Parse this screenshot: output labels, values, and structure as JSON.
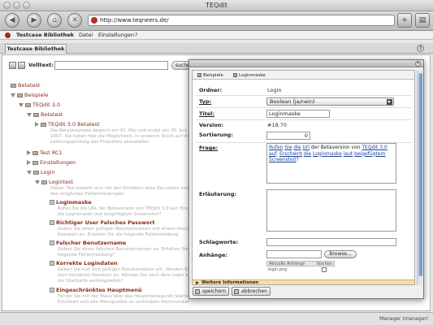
{
  "window": {
    "title": "TEQdit"
  },
  "browser": {
    "url": "http://www.teqneers.de/",
    "back": "◀",
    "forward": "▶",
    "home": "⌂",
    "stop": "✕",
    "bookmark": "+",
    "side": "▤"
  },
  "menubar": {
    "items": [
      "Testcase Bibliothek",
      "Datei",
      "Einstellungen",
      "?"
    ]
  },
  "tab": {
    "label": "Testcase Bibliothek",
    "help": "?"
  },
  "search": {
    "label": "Volltext:",
    "value": "",
    "button": "suche"
  },
  "tree": {
    "nodes": [
      {
        "label": "Betatest"
      },
      {
        "label": "Beispiele"
      },
      {
        "label": "TEQdit 3.0"
      },
      {
        "label": "Betatest"
      },
      {
        "label": "TEQdit 3.0 Betatest"
      },
      {
        "desc": "Die Betatestphase beginnt am 01. Mai und endet am 30. Juni 2007. Sie haben hier die Möglichkeit, in unserem Stück auf die Leistungsprüfung des Produktes abzustellen"
      },
      {
        "label": "Test RC1"
      },
      {
        "label": "Einstellungen"
      },
      {
        "label": "Login"
      },
      {
        "label": "Logintest"
      },
      {
        "desc": "Dieser Test bezieht sich mit den Entitäten alles Benutzers sowie den möglichen Fehlermeldungen"
      },
      {
        "label": "Loginmaske"
      },
      {
        "desc": "Rufen Sie die URL der Betaversion von TEQdit 3.0 auf. Erscheint die Loginmaske laut beigefügtem Screenshot?"
      },
      {
        "label": "Richtiger User Falsches Passwort"
      },
      {
        "desc": "Geben Sie einen gültigen Benutzernamen mit einem falschen Passwort an. Erhalten Sie die folgende Fehlermeldung"
      },
      {
        "label": "Falscher Benutzername"
      },
      {
        "desc": "Geben Sie einen falschen Benutzernamen an. Erhalten Sie die folgende Fehlermeldung?"
      },
      {
        "label": "Korrekte Logindaten"
      },
      {
        "desc": "Geben Sie nun Ihre gültigen Benutzerdaten ein. Werden Sie mit dem korrekten Passwort an. Werden Sie nach dem Login einmal zur Startseite weitergeleitet?"
      },
      {
        "label": "Eingeschränktes Hauptmenü"
      },
      {
        "desc": "Fahren Sie mit der Maus über das Hauptmenüpunkt Startseite. Erscheint sich alle Menüpunkte zu verhindern Kommunikation?"
      }
    ]
  },
  "dialog": {
    "close": "x",
    "tabs": [
      "Beispiele",
      "Loginmaske"
    ],
    "fields": {
      "ordner_label": "Ordner:",
      "ordner_value": "Login",
      "typ_label": "Typ:",
      "typ_value": "Boolean (ja/nein)",
      "titel_label": "Titel:",
      "titel_value": "Loginmaske",
      "version_label": "Version:",
      "version_value": "#18.70",
      "sortierung_label": "Sortierung:",
      "sortierung_value": "0",
      "frage_label": "Frage:",
      "frage_parts": [
        "Rufen",
        " ",
        "Sie",
        " ",
        "die",
        " ",
        "Url",
        " der Betaversion von ",
        "TEQdit 3.0",
        " ",
        "auf",
        ". ",
        "Erscheint",
        " ",
        "die",
        " ",
        "Loginmaske",
        " ",
        "laut",
        " ",
        "beigefügtem",
        " ",
        "Screenshot",
        "?"
      ],
      "erlaeuterung_label": "Erläuterung:",
      "schlagworte_label": "Schlagworte:",
      "anhaenge_label": "Anhänge:",
      "browse": "Browse...",
      "att_col1": "Aktuelle Anhänge",
      "att_col2": "löschen",
      "att_file": "login.png"
    },
    "more": "Weitere Informationen",
    "save": "speichern",
    "cancel": "abbrechen"
  },
  "status": {
    "user": "Manager (manager)"
  }
}
